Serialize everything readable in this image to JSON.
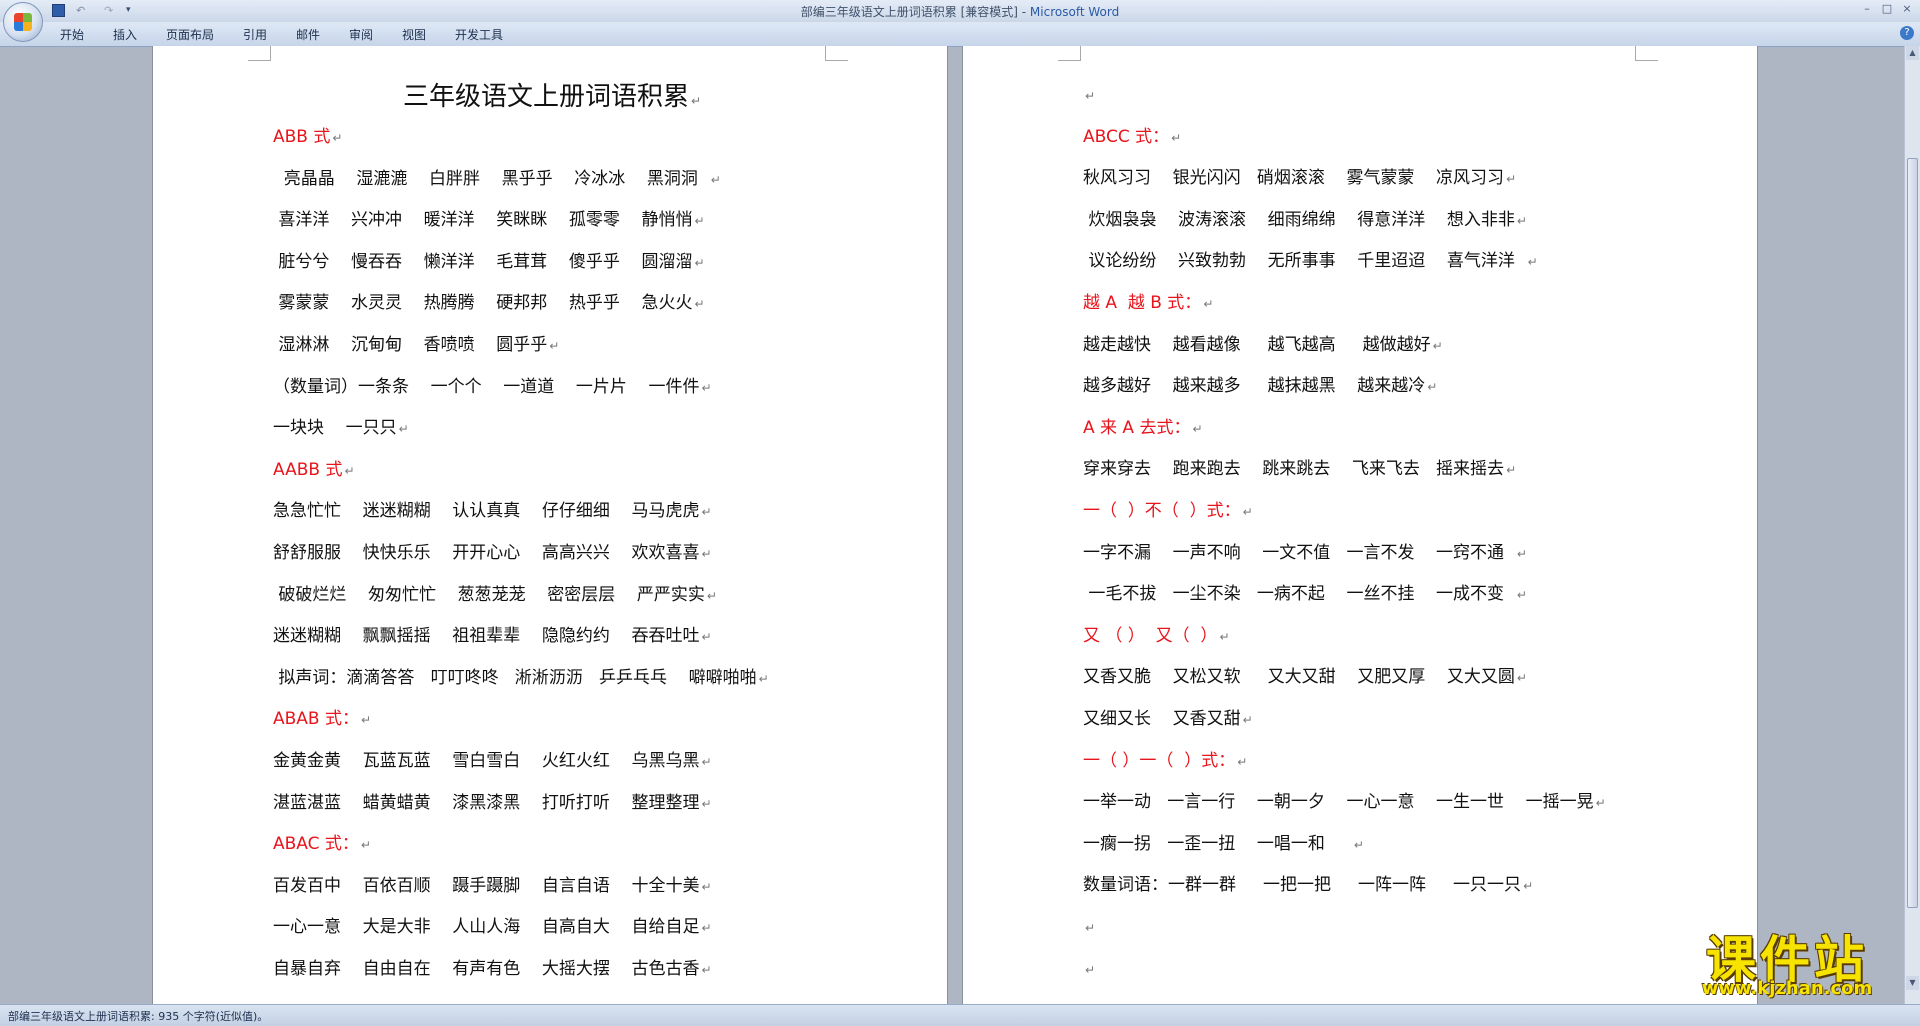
{
  "window": {
    "title": "部编三年级语文上册词语积累 [兼容模式] - ",
    "app": "Microsoft Word"
  },
  "ribbon": {
    "tabs": [
      "开始",
      "插入",
      "页面布局",
      "引用",
      "邮件",
      "审阅",
      "视图",
      "开发工具"
    ]
  },
  "icons": {
    "office": "office-button-icon",
    "save": "save-icon",
    "undo": "undo-icon",
    "redo": "redo-icon",
    "help": "help-icon"
  },
  "document": {
    "title": "三年级语文上册词语积累",
    "page1_lines": [
      {
        "t": "ABB 式",
        "h": true
      },
      {
        "t": "  亮晶晶    湿漉漉    白胖胖    黑乎乎    冷冰冰    黑洞洞  ",
        "h": false
      },
      {
        "t": " 喜洋洋    兴冲冲    暖洋洋    笑眯眯    孤零零    静悄悄",
        "h": false
      },
      {
        "t": " 脏兮兮    慢吞吞    懒洋洋    毛茸茸    傻乎乎    圆溜溜",
        "h": false
      },
      {
        "t": " 雾蒙蒙    水灵灵    热腾腾    硬邦邦    热乎乎    急火火",
        "h": false
      },
      {
        "t": " 湿淋淋    沉甸甸    香喷喷    圆乎乎",
        "h": false
      },
      {
        "t": "（数量词）一条条    一个个    一道道    一片片    一件件",
        "h": false
      },
      {
        "t": "一块块    一只只",
        "h": false
      },
      {
        "t": "AABB 式",
        "h": true
      },
      {
        "t": "急急忙忙    迷迷糊糊    认认真真    仔仔细细    马马虎虎",
        "h": false
      },
      {
        "t": "舒舒服服    快快乐乐    开开心心    高高兴兴    欢欢喜喜",
        "h": false
      },
      {
        "t": " 破破烂烂    匆匆忙忙    葱葱茏茏    密密层层    严严实实",
        "h": false
      },
      {
        "t": "迷迷糊糊    飘飘摇摇    祖祖辈辈    隐隐约约    吞吞吐吐",
        "h": false
      },
      {
        "t": " 拟声词：滴滴答答   叮叮咚咚   淅淅沥沥   乒乒乓乓    噼噼啪啪",
        "h": false
      },
      {
        "t": "ABAB 式：",
        "h": true
      },
      {
        "t": "金黄金黄    瓦蓝瓦蓝    雪白雪白    火红火红    乌黑乌黑",
        "h": false
      },
      {
        "t": "湛蓝湛蓝    蜡黄蜡黄    漆黑漆黑    打听打听    整理整理",
        "h": false
      },
      {
        "t": "ABAC 式：",
        "h": true
      },
      {
        "t": "百发百中    百依百顺    蹑手蹑脚    自言自语    十全十美",
        "h": false
      },
      {
        "t": "一心一意    大是大非    人山人海    自高自大    自给自足",
        "h": false
      },
      {
        "t": "自暴自弃    自由自在    有声有色    大摇大摆    古色古香",
        "h": false
      }
    ],
    "page2_lines": [
      {
        "t": "",
        "h": false
      },
      {
        "t": "ABCC 式：",
        "h": true
      },
      {
        "t": "秋风习习    银光闪闪   硝烟滚滚    雾气蒙蒙    凉风习习",
        "h": false
      },
      {
        "t": " 炊烟袅袅    波涛滚滚    细雨绵绵    得意洋洋    想入非非",
        "h": false
      },
      {
        "t": " 议论纷纷    兴致勃勃    无所事事    千里迢迢    喜气洋洋  ",
        "h": false
      },
      {
        "t": "越 A  越 B 式：",
        "h": true
      },
      {
        "t": "越走越快    越看越像     越飞越高     越做越好",
        "h": false
      },
      {
        "t": "越多越好    越来越多     越抹越黑    越来越冷",
        "h": false
      },
      {
        "t": "A 来 A 去式：",
        "h": true
      },
      {
        "t": "穿来穿去    跑来跑去    跳来跳去    飞来飞去   摇来摇去",
        "h": false
      },
      {
        "t": "一（  ）不（  ）式：",
        "h": true
      },
      {
        "t": "一字不漏    一声不响    一文不值   一言不发    一窍不通  ",
        "h": false
      },
      {
        "t": " 一毛不拔   一尘不染   一病不起    一丝不挂    一成不变  ",
        "h": false
      },
      {
        "t": "又 （ ）  又（  ）",
        "h": true
      },
      {
        "t": "又香又脆    又松又软     又大又甜    又肥又厚    又大又圆",
        "h": false
      },
      {
        "t": "又细又长    又香又甜",
        "h": false
      },
      {
        "t": "一（ ）一（  ）式：",
        "h": true
      },
      {
        "t": "一举一动   一言一行    一朝一夕    一心一意    一生一世    一摇一晃",
        "h": false
      },
      {
        "t": "一瘸一拐   一歪一扭    一唱一和     ",
        "h": false
      },
      {
        "t": "数量词语：一群一群     一把一把     一阵一阵     一只一只",
        "h": false
      },
      {
        "t": "",
        "h": false
      },
      {
        "t": "",
        "h": false
      }
    ]
  },
  "status": {
    "text": "部编三年级语文上册词语积累: 935 个字符(近似值)。"
  },
  "watermark": {
    "main": "课件站",
    "url": "www.kjzhan.com"
  }
}
